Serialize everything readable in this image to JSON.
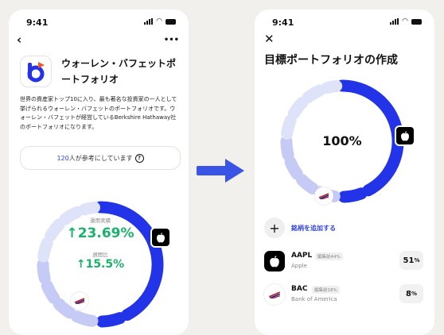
{
  "left": {
    "status_time": "9:41",
    "back_icon": "‹",
    "more_icon": "•••",
    "title": "ウォーレン・バフェットポートフォリオ",
    "description": "世界の資産家トップ10に入り、最も著名な投資家の一人として挙げられるウォーレン・バフェットのポートフォリオです。ウォーレン・バフェットが経営しているBerkshire Hathaway社のポートフォリオになります。",
    "ref_count": "120",
    "ref_text": "人が参考にしています",
    "ring": {
      "label1": "運用実績",
      "value1": "23.69%",
      "label2": "週間比",
      "value2": "15.5%",
      "accent": "#2233e8",
      "muted": "#c5cbf5",
      "value_color": "#19b26b"
    }
  },
  "arrow_color": "#3a55e6",
  "right": {
    "status_time": "9:41",
    "close_icon": "✕",
    "title": "目標ポートフォリオの作成",
    "ring_percent": "100%",
    "add_icon": "+",
    "add_label": "銘柄を追加する",
    "stocks": [
      {
        "ticker": "AAPL",
        "tag": "編集前44%",
        "name": "Apple",
        "pct": "51",
        "pct_unit": "%"
      },
      {
        "ticker": "BAC",
        "tag": "編集前18%",
        "name": "Bank of America",
        "pct": "8",
        "pct_unit": "%"
      }
    ]
  }
}
